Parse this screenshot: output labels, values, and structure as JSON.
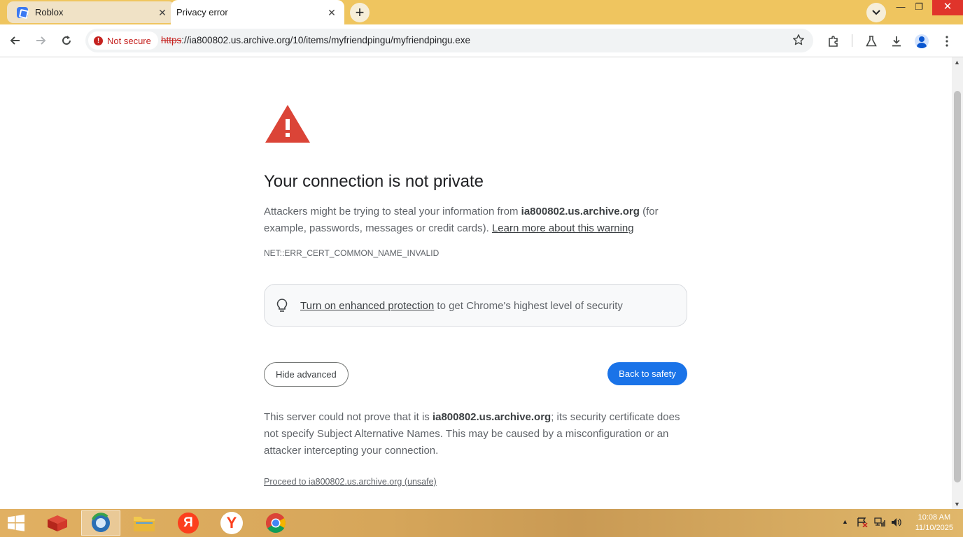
{
  "browser": {
    "tabs": [
      {
        "title": "Roblox",
        "active": false
      },
      {
        "title": "Privacy error",
        "active": true
      }
    ],
    "new_tab": "+",
    "security_chip": "Not secure",
    "url_scheme": "https",
    "url_rest": "://ia800802.us.archive.org/10/items/myfriendpingu/myfriendpingu.exe"
  },
  "page": {
    "heading": "Your connection is not private",
    "intro_before": "Attackers might be trying to steal your information from ",
    "host": "ia800802.us.archive.org",
    "intro_after": " (for example, passwords, messages or credit cards). ",
    "learn_more": "Learn more about this warning",
    "error_code": "NET::ERR_CERT_COMMON_NAME_INVALID",
    "enhanced_link": "Turn on enhanced protection",
    "enhanced_rest": " to get Chrome's highest level of security",
    "hide_advanced": "Hide advanced",
    "back_to_safety": "Back to safety",
    "details_before": "This server could not prove that it is ",
    "details_host": "ia800802.us.archive.org",
    "details_after": "; its security certificate does not specify Subject Alternative Names. This may be caused by a misconfiguration or an attacker intercepting your connection.",
    "proceed": "Proceed to ia800802.us.archive.org (unsafe)"
  },
  "taskbar": {
    "time": "10:08 AM",
    "date": "11/10/2025",
    "yandex_letter": "Я",
    "yandex_browser_letter": "Y"
  },
  "colors": {
    "tab_strip": "#efc55f",
    "accent_blue": "#1a73e8",
    "warning_red": "#db4437"
  }
}
